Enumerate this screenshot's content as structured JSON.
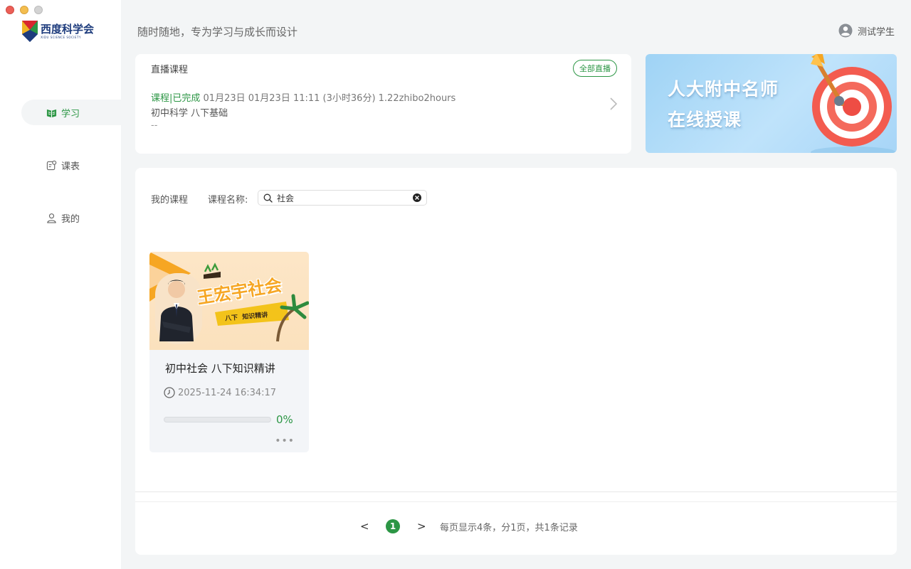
{
  "window": {
    "title": "西度科学会"
  },
  "logo": {
    "cn": "西度科学会",
    "en": "XIDU SCIENCE SOCIETY"
  },
  "sidebar": {
    "items": [
      {
        "label": "学习",
        "icon": "book-icon",
        "active": true
      },
      {
        "label": "课表",
        "icon": "schedule-icon",
        "active": false
      },
      {
        "label": "我的",
        "icon": "user-icon",
        "active": false
      }
    ]
  },
  "header": {
    "slogan": "随时随地，专为学习与成长而设计",
    "user_name": "测试学生"
  },
  "live": {
    "title": "直播课程",
    "all_button": "全部直播",
    "status": "课程|已完成",
    "info": "01月23日 01月23日 11:11 (3小时36分) 1.22zhibo2hours",
    "course": "初中科学 八下基础",
    "extra": "--"
  },
  "banner": {
    "line1": "人大附中名师",
    "line2": "在线授课"
  },
  "courses": {
    "tab_label": "我的课程",
    "search_label": "课程名称:",
    "search_value": "社会",
    "items": [
      {
        "thumb_title": "王宏宇社会",
        "thumb_tag": "八下  知识精讲",
        "title": "初中社会 八下知识精讲",
        "time": "2025-11-24 16:34:17",
        "progress": 0,
        "progress_text": "0%",
        "more": "•••"
      }
    ]
  },
  "pager": {
    "prev": "<",
    "current": "1",
    "next": ">",
    "info": "每页显示4条，分1页，共1条记录"
  },
  "colors": {
    "accent": "#2c9645",
    "sidebar_bg": "#ffffff",
    "page_bg": "#f3f5f6"
  }
}
